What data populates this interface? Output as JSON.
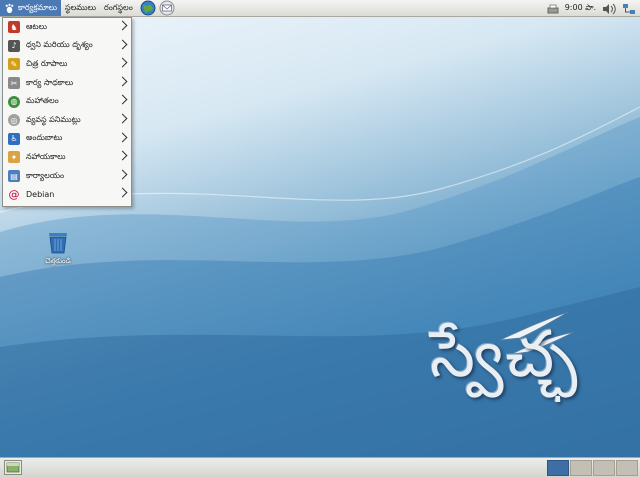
{
  "top_panel": {
    "menus": [
      {
        "label": "కార్యక్రమాలు"
      },
      {
        "label": "స్థలములు"
      },
      {
        "label": "రంగస్థలం"
      }
    ],
    "launchers": [
      "web-browser-icon",
      "mail-client-icon"
    ],
    "clock": "9:00 పా.",
    "tray_icons": [
      "printer-icon",
      "volume-icon",
      "network-icon"
    ]
  },
  "app_menu": {
    "items": [
      {
        "label": "ఆటలు",
        "icon": "games-icon",
        "color": "#c0392b"
      },
      {
        "label": "ధ్వని మరియు దృశ్యం",
        "icon": "sound-video-icon",
        "color": "#555555"
      },
      {
        "label": "చిత్ర రూపాలు",
        "icon": "graphics-icon",
        "color": "#d4a017"
      },
      {
        "label": "కార్య సాధకాలు",
        "icon": "accessories-icon",
        "color": "#8a8a8a"
      },
      {
        "label": "మహాతలం",
        "icon": "internet-icon",
        "color": "#3f8f3f"
      },
      {
        "label": "వ్యవస్థ పనిముట్లు",
        "icon": "system-tools-icon",
        "color": "#a0a0a0"
      },
      {
        "label": "అందుబాటు",
        "icon": "accessibility-icon",
        "color": "#2f6fbf"
      },
      {
        "label": "నహాయకాలు",
        "icon": "education-icon",
        "color": "#d9a441"
      },
      {
        "label": "కార్యాలయం",
        "icon": "office-icon",
        "color": "#4c7fc0"
      },
      {
        "label": "Debian",
        "icon": "debian-icon",
        "color": "#c70036"
      }
    ]
  },
  "desktop": {
    "trash_label": "చెత్తకుండి",
    "logo_text": "స్వేచ్ఛ"
  },
  "bottom_panel": {
    "workspaces": 4,
    "active_workspace": 1
  },
  "colors": {
    "menu_highlight": "#4a79b5",
    "workspace_active": "#3e6ea3"
  }
}
